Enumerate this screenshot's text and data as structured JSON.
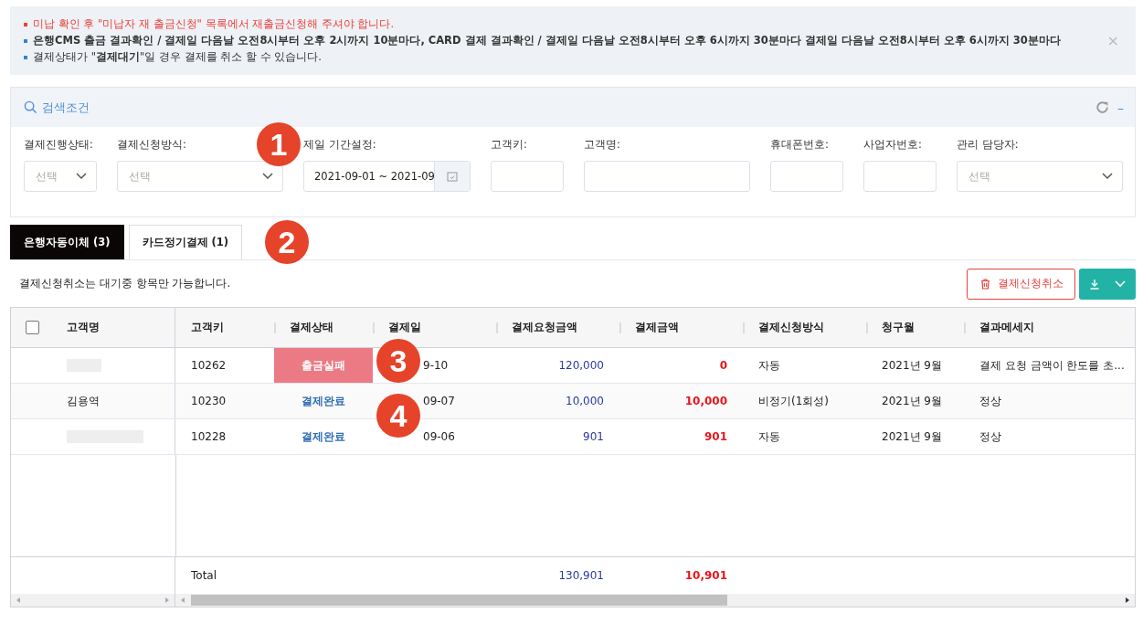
{
  "notices": [
    {
      "text": "미납 확인 후 \"미납자 재 출금신청\" 목록에서 재출금신청해 주셔야 합니다.",
      "color": "#e8413b",
      "bold": false
    },
    {
      "text": "은행CMS 출금 결과확인 / 결제일 다음날 오전8시부터 오후 2시까지 10분마다, CARD 결제 결과확인 / 결제일 다음날 오전8시부터 오후 6시까지 30분마다 결제일 다음날 오전8시부터 오후 6시까지 30분마다",
      "color": "#3c7fd0",
      "bold": true
    },
    {
      "text": "결제상태가 \"**결제대기**\"일 경우 결제를 취소 할 수 있습니다.",
      "color": "#3c7fd0",
      "bold": false
    }
  ],
  "close_icon": "×",
  "search_panel": {
    "title": "검색조건",
    "collapse": "–",
    "filters": [
      {
        "kind": "select",
        "label": "결제진행상태:",
        "placeholder": "선택"
      },
      {
        "kind": "select",
        "label": "결제신청방식:",
        "placeholder": "선택"
      },
      {
        "kind": "date",
        "label": "제일 기간설정:",
        "value": "2021-09-01 ~ 2021-09"
      },
      {
        "kind": "text",
        "label": "고객키:"
      },
      {
        "kind": "text",
        "label": "고객명:"
      },
      {
        "kind": "text",
        "label": "휴대폰번호:"
      },
      {
        "kind": "text",
        "label": "사업자번호:"
      },
      {
        "kind": "select",
        "label": "관리 담당자:",
        "placeholder": "선택"
      }
    ]
  },
  "tabs": [
    {
      "label": "은행자동이체 (3)",
      "selected": true
    },
    {
      "label": "카드정기결제 (1)",
      "selected": false
    }
  ],
  "hint": "결제신청취소는 대기중 항목만 가능합니다.",
  "cancel_button": "결제신청취소",
  "table": {
    "select_all": {
      "checked": false
    },
    "columns": [
      "고객명",
      "고객키",
      "결제상태",
      "결제일",
      "결제요청금액",
      "결제금액",
      "결제신청방식",
      "청구월",
      "결과메세지"
    ],
    "rows": [
      {
        "masked": true,
        "key": "10262",
        "status": "출금실패",
        "failed": true,
        "date": "9-10",
        "request": "120,000",
        "amount": "0",
        "method": "자동",
        "month": "2021년 9월",
        "message": "결제 요청 금액이 한도를 초..."
      },
      {
        "masked": false,
        "name": "김용역",
        "key": "10230",
        "status": "결제완료",
        "failed": false,
        "date": "09-07",
        "request": "10,000",
        "amount": "10,000",
        "method": "비정기(1회성)",
        "month": "2021년 9월",
        "message": "정상"
      },
      {
        "masked": true,
        "key": "10228",
        "status": "결제완료",
        "failed": false,
        "date": "09-06",
        "request": "901",
        "amount": "901",
        "method": "자동",
        "month": "2021년 9월",
        "message": "정상"
      }
    ],
    "total": {
      "label": "Total",
      "request": "130,901",
      "amount": "10,901"
    }
  },
  "callouts": [
    "1",
    "2",
    "3",
    "4"
  ]
}
